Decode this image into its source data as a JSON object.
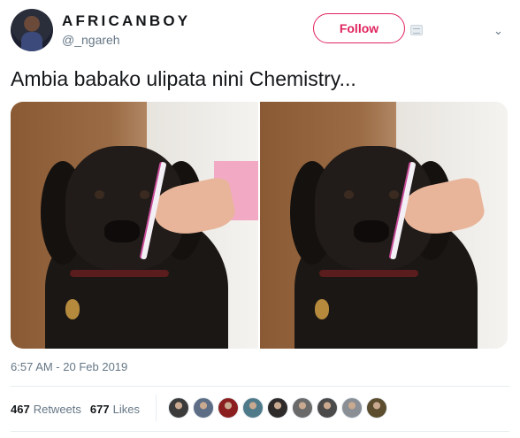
{
  "author": {
    "display_name": "AFRICANBOY",
    "handle": "@_ngareh"
  },
  "actions": {
    "follow_label": "Follow"
  },
  "tweet": {
    "text": "Ambia babako ulipata nini Chemistry...",
    "timestamp": "6:57 AM - 20 Feb 2019"
  },
  "stats": {
    "retweets_count": "467",
    "retweets_label": "Retweets",
    "likes_count": "677",
    "likes_label": "Likes"
  },
  "likers": [
    {
      "icon": "liker-avatar",
      "color": "#3b3b3b"
    },
    {
      "icon": "liker-avatar",
      "color": "#5e6d86"
    },
    {
      "icon": "liker-avatar",
      "color": "#8b1e1e"
    },
    {
      "icon": "liker-avatar",
      "color": "#4f7a8a"
    },
    {
      "icon": "liker-avatar",
      "color": "#2e2a2a"
    },
    {
      "icon": "liker-avatar",
      "color": "#6a6a6a"
    },
    {
      "icon": "liker-avatar",
      "color": "#4a4a4a"
    },
    {
      "icon": "liker-avatar",
      "color": "#8a8f96"
    },
    {
      "icon": "liker-avatar",
      "color": "#5b4d2e"
    }
  ],
  "colors": {
    "accent": "#e0245e",
    "text_primary": "#14171a",
    "text_secondary": "#657786",
    "divider": "#e6ecf0"
  },
  "icons": {
    "caret": "chevron-down-icon",
    "card": "card-icon"
  }
}
